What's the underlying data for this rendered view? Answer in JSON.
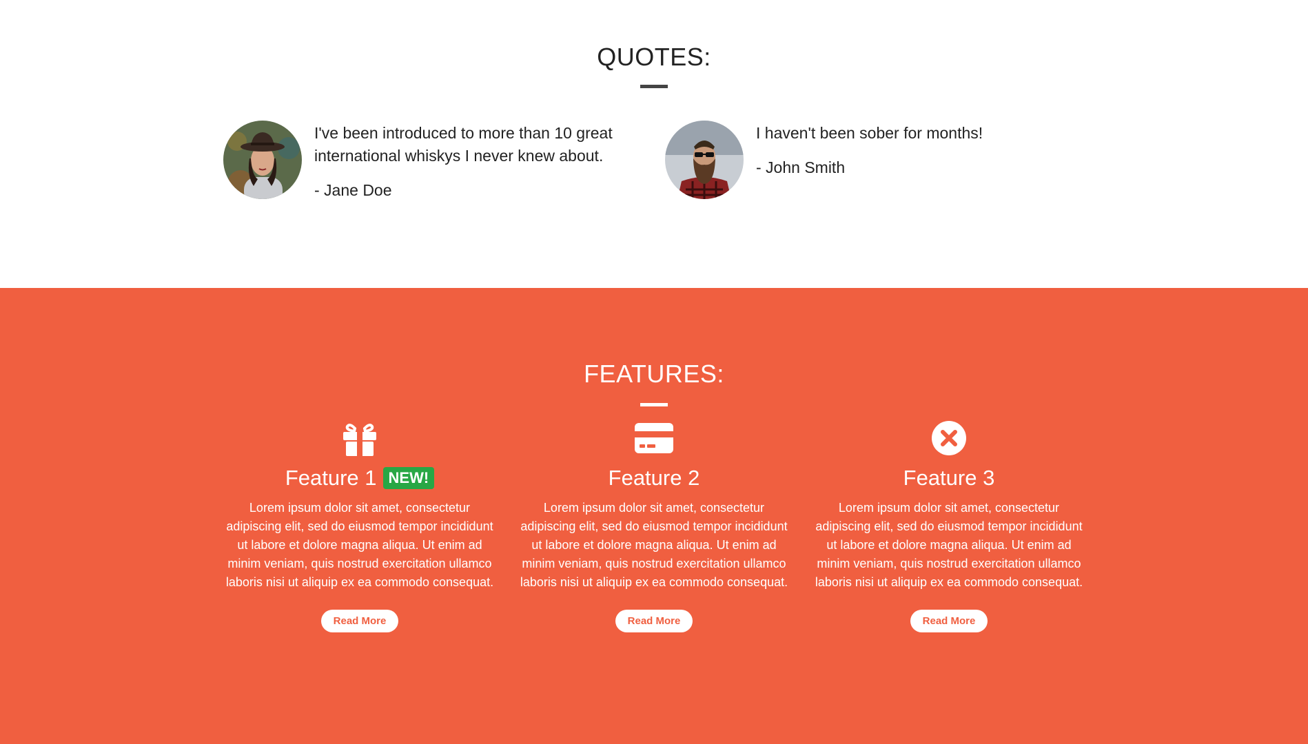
{
  "quotes": {
    "title": "QUOTES:",
    "items": [
      {
        "text": "I've been introduced to more than 10 great international whiskys I never knew about.",
        "author": "- Jane Doe",
        "avatar": "woman-in-hat-photo"
      },
      {
        "text": "I haven't been sober for months!",
        "author": "- John Smith",
        "avatar": "bearded-man-sunglasses-photo"
      }
    ]
  },
  "features": {
    "title": "FEATURES:",
    "accent_color": "#f05f40",
    "badge_color": "#28a745",
    "items": [
      {
        "icon": "gift-icon",
        "title": "Feature 1",
        "badge": "NEW!",
        "text": "Lorem ipsum dolor sit amet, consectetur adipiscing elit, sed do eiusmod tempor incididunt ut labore et dolore magna aliqua. Ut enim ad minim veniam, quis nostrud exercitation ullamco laboris nisi ut aliquip ex ea commodo consequat.",
        "button": "Read More"
      },
      {
        "icon": "credit-card-icon",
        "title": "Feature 2",
        "text": "Lorem ipsum dolor sit amet, consectetur adipiscing elit, sed do eiusmod tempor incididunt ut labore et dolore magna aliqua. Ut enim ad minim veniam, quis nostrud exercitation ullamco laboris nisi ut aliquip ex ea commodo consequat.",
        "button": "Read More"
      },
      {
        "icon": "times-circle-icon",
        "title": "Feature 3",
        "text": "Lorem ipsum dolor sit amet, consectetur adipiscing elit, sed do eiusmod tempor incididunt ut labore et dolore magna aliqua. Ut enim ad minim veniam, quis nostrud exercitation ullamco laboris nisi ut aliquip ex ea commodo consequat.",
        "button": "Read More"
      }
    ]
  }
}
